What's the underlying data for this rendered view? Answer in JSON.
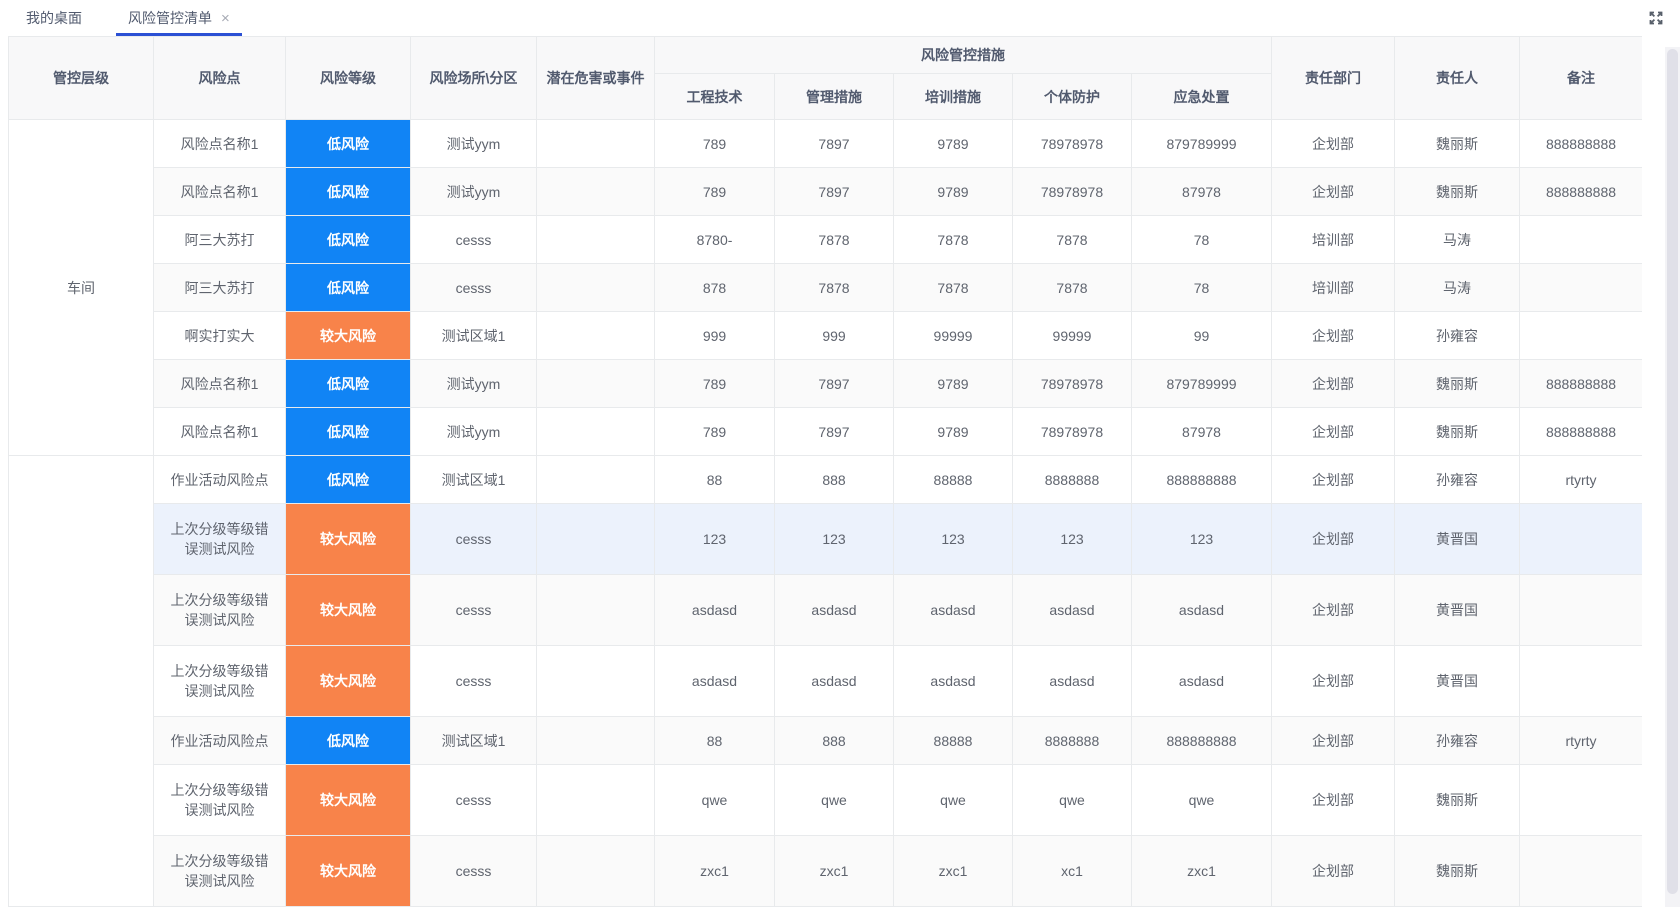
{
  "tabs": [
    {
      "label": "我的桌面",
      "active": false
    },
    {
      "label": "风险管控清单",
      "active": true,
      "close_icon": "×"
    }
  ],
  "window": {
    "expand_icon": "fullscreen-arrows"
  },
  "colors": {
    "low_risk_badge": "#1184f5",
    "high_risk_badge": "#f8834a",
    "highlight_row": "#ecf2fc",
    "stripe_row": "#fafafa",
    "header_bg": "#f8f8f9",
    "border": "#e8eaec",
    "tab_active_underline": "#2b50d4"
  },
  "table": {
    "headers": {
      "control_level": "管控层级",
      "risk_point": "风险点",
      "risk_level": "风险等级",
      "risk_area": "风险场所\\分区",
      "potential_hazard": "潜在危害或事件",
      "measures_group": "风险管控措施",
      "measures": [
        "工程技术",
        "管理措施",
        "培训措施",
        "个体防护",
        "应急处置"
      ],
      "department": "责任部门",
      "person": "责任人",
      "remark": "备注"
    },
    "groups": [
      {
        "control_level": "车间",
        "rows": [
          {
            "risk_point": "风险点名称1",
            "risk_level": {
              "label": "低风险",
              "level": "low"
            },
            "risk_area": "测试yym",
            "potential_hazard": "",
            "measures": [
              "789",
              "7897",
              "9789",
              "78978978",
              "879789999"
            ],
            "department": "企划部",
            "person": "魏丽斯",
            "remark": "888888888",
            "bg": "white",
            "tall": false
          },
          {
            "risk_point": "风险点名称1",
            "risk_level": {
              "label": "低风险",
              "level": "low"
            },
            "risk_area": "测试yym",
            "potential_hazard": "",
            "measures": [
              "789",
              "7897",
              "9789",
              "78978978",
              "87978"
            ],
            "department": "企划部",
            "person": "魏丽斯",
            "remark": "888888888",
            "bg": "stripe",
            "tall": false
          },
          {
            "risk_point": "阿三大苏打",
            "risk_level": {
              "label": "低风险",
              "level": "low"
            },
            "risk_area": "cesss",
            "potential_hazard": "",
            "measures": [
              "8780-",
              "7878",
              "7878",
              "7878",
              "78"
            ],
            "department": "培训部",
            "person": "马涛",
            "remark": "",
            "bg": "white",
            "tall": false
          },
          {
            "risk_point": "阿三大苏打",
            "risk_level": {
              "label": "低风险",
              "level": "low"
            },
            "risk_area": "cesss",
            "potential_hazard": "",
            "measures": [
              "878",
              "7878",
              "7878",
              "7878",
              "78"
            ],
            "department": "培训部",
            "person": "马涛",
            "remark": "",
            "bg": "stripe",
            "tall": false
          },
          {
            "risk_point": "啊实打实大",
            "risk_level": {
              "label": "较大风险",
              "level": "high"
            },
            "risk_area": "测试区域1",
            "potential_hazard": "",
            "measures": [
              "999",
              "999",
              "99999",
              "99999",
              "99"
            ],
            "department": "企划部",
            "person": "孙雍容",
            "remark": "",
            "bg": "white",
            "tall": false
          },
          {
            "risk_point": "风险点名称1",
            "risk_level": {
              "label": "低风险",
              "level": "low"
            },
            "risk_area": "测试yym",
            "potential_hazard": "",
            "measures": [
              "789",
              "7897",
              "9789",
              "78978978",
              "879789999"
            ],
            "department": "企划部",
            "person": "魏丽斯",
            "remark": "888888888",
            "bg": "stripe",
            "tall": false
          },
          {
            "risk_point": "风险点名称1",
            "risk_level": {
              "label": "低风险",
              "level": "low"
            },
            "risk_area": "测试yym",
            "potential_hazard": "",
            "measures": [
              "789",
              "7897",
              "9789",
              "78978978",
              "87978"
            ],
            "department": "企划部",
            "person": "魏丽斯",
            "remark": "888888888",
            "bg": "white",
            "tall": false
          }
        ]
      },
      {
        "control_level": "",
        "rows": [
          {
            "risk_point": "作业活动风险点",
            "risk_level": {
              "label": "低风险",
              "level": "low"
            },
            "risk_area": "测试区域1",
            "potential_hazard": "",
            "measures": [
              "88",
              "888",
              "88888",
              "8888888",
              "888888888"
            ],
            "department": "企划部",
            "person": "孙雍容",
            "remark": "rtyrty",
            "bg": "white",
            "tall": false
          },
          {
            "risk_point": "上次分级等级错误测试风险",
            "risk_level": {
              "label": "较大风险",
              "level": "high"
            },
            "risk_area": "cesss",
            "potential_hazard": "",
            "measures": [
              "123",
              "123",
              "123",
              "123",
              "123"
            ],
            "department": "企划部",
            "person": "黄晋国",
            "remark": "",
            "bg": "highlight",
            "tall": true
          },
          {
            "risk_point": "上次分级等级错误测试风险",
            "risk_level": {
              "label": "较大风险",
              "level": "high"
            },
            "risk_area": "cesss",
            "potential_hazard": "",
            "measures": [
              "asdasd",
              "asdasd",
              "asdasd",
              "asdasd",
              "asdasd"
            ],
            "department": "企划部",
            "person": "黄晋国",
            "remark": "",
            "bg": "stripe",
            "tall": true
          },
          {
            "risk_point": "上次分级等级错误测试风险",
            "risk_level": {
              "label": "较大风险",
              "level": "high"
            },
            "risk_area": "cesss",
            "potential_hazard": "",
            "measures": [
              "asdasd",
              "asdasd",
              "asdasd",
              "asdasd",
              "asdasd"
            ],
            "department": "企划部",
            "person": "黄晋国",
            "remark": "",
            "bg": "white",
            "tall": true
          },
          {
            "risk_point": "作业活动风险点",
            "risk_level": {
              "label": "低风险",
              "level": "low"
            },
            "risk_area": "测试区域1",
            "potential_hazard": "",
            "measures": [
              "88",
              "888",
              "88888",
              "8888888",
              "888888888"
            ],
            "department": "企划部",
            "person": "孙雍容",
            "remark": "rtyrty",
            "bg": "stripe",
            "tall": false
          },
          {
            "risk_point": "上次分级等级错误测试风险",
            "risk_level": {
              "label": "较大风险",
              "level": "high"
            },
            "risk_area": "cesss",
            "potential_hazard": "",
            "measures": [
              "qwe",
              "qwe",
              "qwe",
              "qwe",
              "qwe"
            ],
            "department": "企划部",
            "person": "魏丽斯",
            "remark": "",
            "bg": "white",
            "tall": true
          },
          {
            "risk_point": "上次分级等级错误测试风险",
            "risk_level": {
              "label": "较大风险",
              "level": "high"
            },
            "risk_area": "cesss",
            "potential_hazard": "",
            "measures": [
              "zxc1",
              "zxc1",
              "zxc1",
              "xc1",
              "zxc1"
            ],
            "department": "企划部",
            "person": "魏丽斯",
            "remark": "",
            "bg": "stripe",
            "tall": true
          }
        ]
      }
    ]
  }
}
